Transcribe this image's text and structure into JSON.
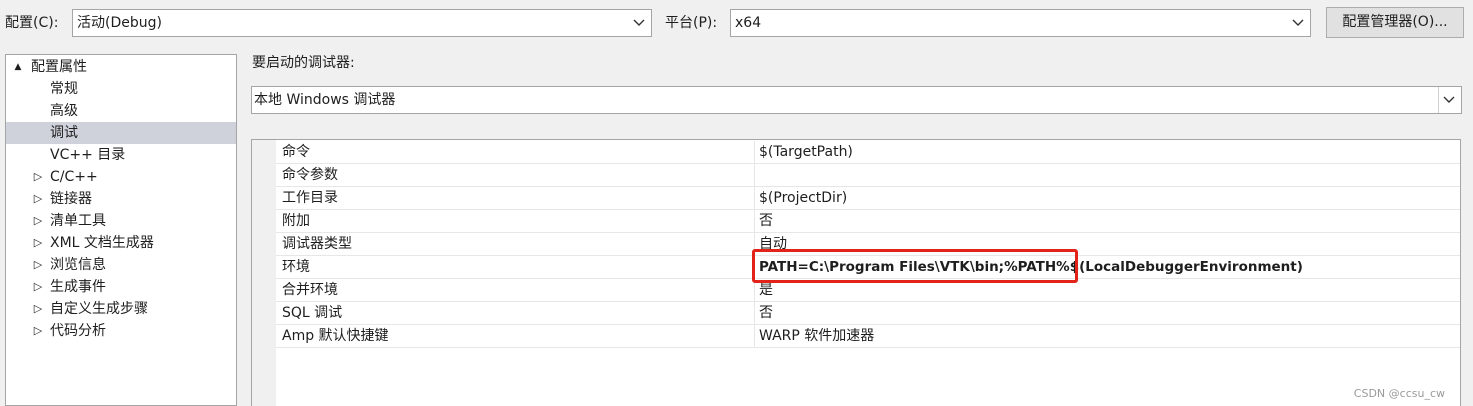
{
  "toolbar": {
    "config_label": "配置(C):",
    "config_value": "活动(Debug)",
    "platform_label": "平台(P):",
    "platform_value": "x64",
    "config_manager_label": "配置管理器(O)..."
  },
  "tree": {
    "items": [
      {
        "label": "配置属性",
        "expander": "▲"
      },
      {
        "label": "常规",
        "expander": ""
      },
      {
        "label": "高级",
        "expander": ""
      },
      {
        "label": "调试",
        "expander": ""
      },
      {
        "label": "VC++ 目录",
        "expander": ""
      },
      {
        "label": "C/C++",
        "expander": "▷"
      },
      {
        "label": "链接器",
        "expander": "▷"
      },
      {
        "label": "清单工具",
        "expander": "▷"
      },
      {
        "label": "XML 文档生成器",
        "expander": "▷"
      },
      {
        "label": "浏览信息",
        "expander": "▷"
      },
      {
        "label": "生成事件",
        "expander": "▷"
      },
      {
        "label": "自定义生成步骤",
        "expander": "▷"
      },
      {
        "label": "代码分析",
        "expander": "▷"
      }
    ]
  },
  "debugger": {
    "label": "要启动的调试器:",
    "value": "本地 Windows 调试器"
  },
  "properties": [
    {
      "name": "命令",
      "value": "$(TargetPath)"
    },
    {
      "name": "命令参数",
      "value": ""
    },
    {
      "name": "工作目录",
      "value": "$(ProjectDir)"
    },
    {
      "name": "附加",
      "value": "否"
    },
    {
      "name": "调试器类型",
      "value": "自动"
    },
    {
      "name": "环境",
      "value": "PATH=C:\\Program Files\\VTK\\bin;%PATH%$(LocalDebuggerEnvironment)"
    },
    {
      "name": "合并环境",
      "value": "是"
    },
    {
      "name": "SQL 调试",
      "value": "否"
    },
    {
      "name": "Amp 默认快捷键",
      "value": "WARP 软件加速器"
    }
  ],
  "watermark": "CSDN @ccsu_cw",
  "colors": {
    "highlight_border": "#e2231a",
    "selected_tree_bg": "#cfd2db"
  }
}
